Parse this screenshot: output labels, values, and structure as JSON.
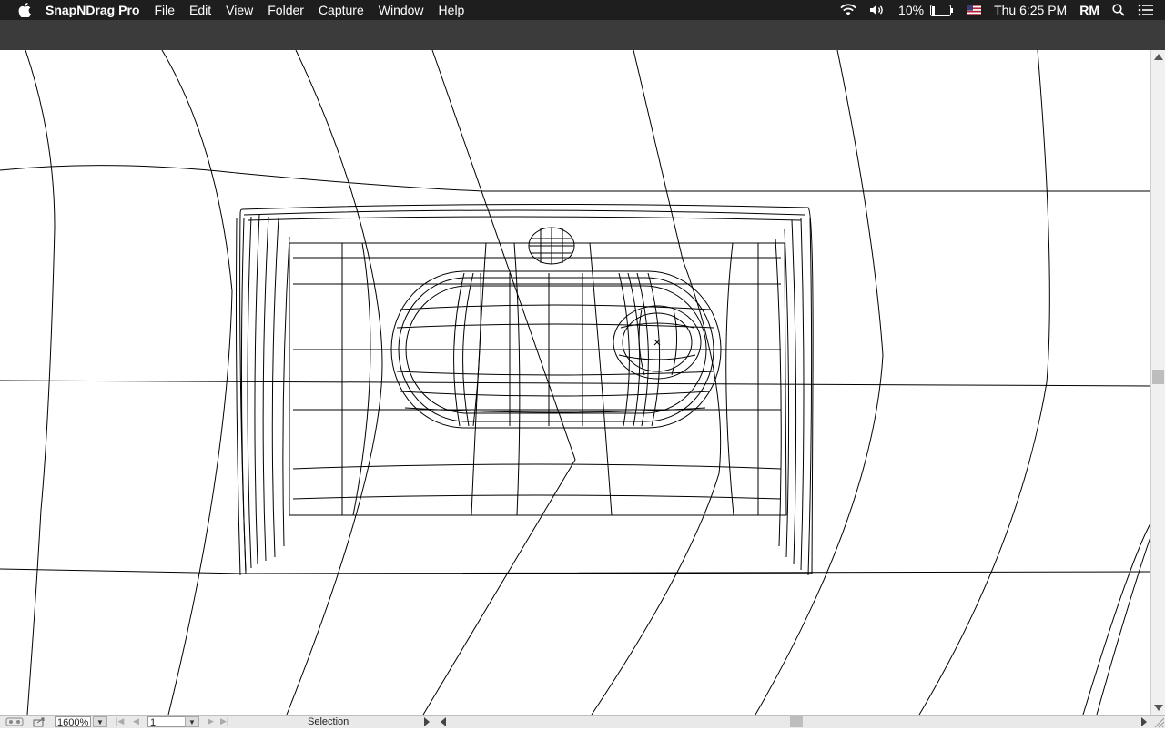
{
  "menubar": {
    "app_name": "SnapNDrag Pro",
    "items": [
      "File",
      "Edit",
      "View",
      "Folder",
      "Capture",
      "Window",
      "Help"
    ],
    "battery": "10%",
    "clock": "Thu 6:25 PM",
    "user": "RM"
  },
  "statusbar": {
    "zoom": "1600%",
    "page": "1",
    "tool": "Selection"
  }
}
